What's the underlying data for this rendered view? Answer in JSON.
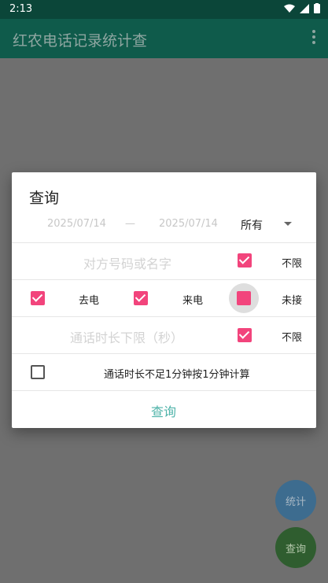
{
  "status": {
    "time": "2:13"
  },
  "app": {
    "title": "红农电话记录统计查"
  },
  "dialog": {
    "title": "查询",
    "date_start": "2025/07/14",
    "dash": "—",
    "date_end": "2025/07/14",
    "type_select": "所有",
    "contact_placeholder": "对方号码或名字",
    "unlimited_label": "不限",
    "outgoing_label": "去电",
    "incoming_label": "来电",
    "missed_label": "未接",
    "duration_placeholder": "通话时长下限（秒）",
    "duration_unlimited_label": "不限",
    "round_minute_label": "通话时长不足1分钟按1分钟计算",
    "query_button": "查询"
  },
  "fabs": {
    "stats": "统计",
    "query": "查询"
  },
  "checkboxes": {
    "contact_unlimited": true,
    "outgoing": true,
    "incoming": true,
    "missed": true,
    "duration_unlimited": true,
    "round_minute": false
  },
  "colors": {
    "accent": "#f2447c",
    "primary_dark": "#0b4639",
    "primary": "#0f5b4b",
    "button_text": "#4fb3a9"
  }
}
